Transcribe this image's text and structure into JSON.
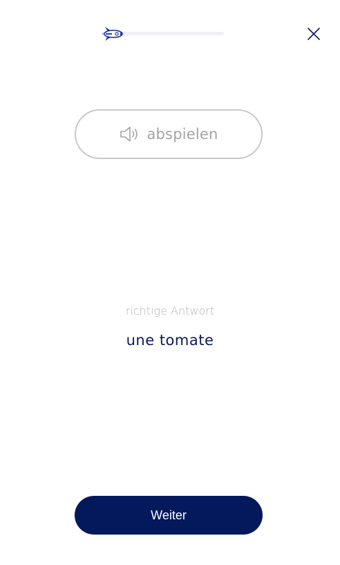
{
  "progress": {
    "value_percent": 18,
    "track_color": "#f0f1f4",
    "fill_color": "#dfe3ee",
    "icon": "rocket-icon"
  },
  "close": {
    "icon": "close-icon"
  },
  "audio": {
    "label": "abspielen",
    "icon": "speaker-icon"
  },
  "answer": {
    "caption": "richtige Antwort",
    "text": "une tomate"
  },
  "continue": {
    "label": "Weiter"
  },
  "colors": {
    "primary": "#04185c",
    "answer_text": "#0b1a5c",
    "muted_text": "#b3b3b3",
    "outline": "#c9c9c9"
  }
}
